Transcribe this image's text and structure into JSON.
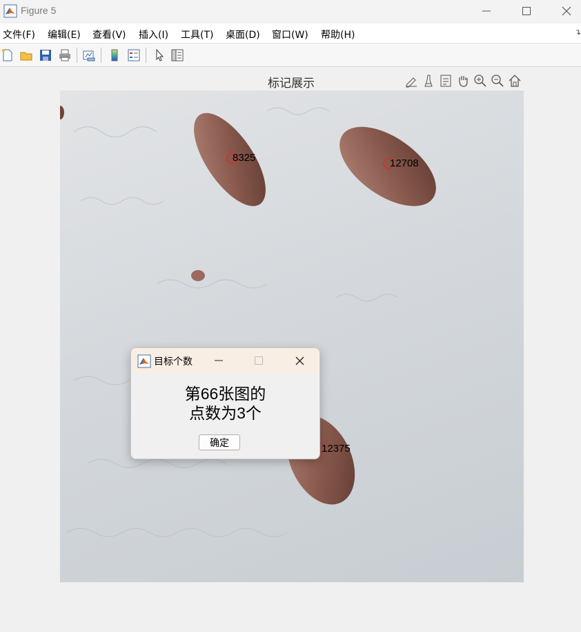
{
  "window": {
    "title": "Figure 5"
  },
  "menu": [
    "文件(F)",
    "编辑(E)",
    "查看(V)",
    "插入(I)",
    "工具(T)",
    "桌面(D)",
    "窗口(W)",
    "帮助(H)"
  ],
  "axes": {
    "title": "标记展示"
  },
  "markers": [
    {
      "label": "8325"
    },
    {
      "label": "12708"
    },
    {
      "label": "12375"
    }
  ],
  "dialog": {
    "title": "目标个数",
    "message_line1": "第66张图的",
    "message_line2": "点数为3个",
    "ok_label": "确定"
  },
  "colors": {
    "marker": "#d03030",
    "seed": "#8a5a4e",
    "dialog_titlebar": "#f8eee4"
  }
}
